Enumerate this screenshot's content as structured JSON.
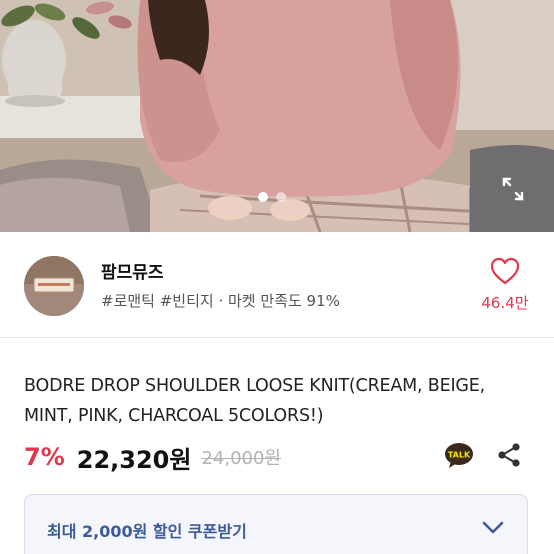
{
  "gallery": {
    "dots": [
      true,
      false
    ]
  },
  "shop": {
    "name": "팜므뮤즈",
    "tags": "#로맨틱 #빈티지 · 마켓 만족도 91%",
    "like_count": "46.4만",
    "like_color": "#e0394f"
  },
  "product": {
    "title": "BODRE DROP SHOULDER LOOSE KNIT(CREAM, BEIGE, MINT, PINK, CHARCOAL 5COLORS!)",
    "discount": "7%",
    "price": "22,320원",
    "original_price": "24,000원",
    "talk_label": "TALK"
  },
  "coupon": {
    "label": "최대 2,000원 할인 쿠폰받기",
    "accent_color": "#3d5a98"
  },
  "icons": [
    "expand-icon",
    "heart-icon",
    "kakaotalk-icon",
    "share-icon",
    "chevron-down-icon"
  ]
}
